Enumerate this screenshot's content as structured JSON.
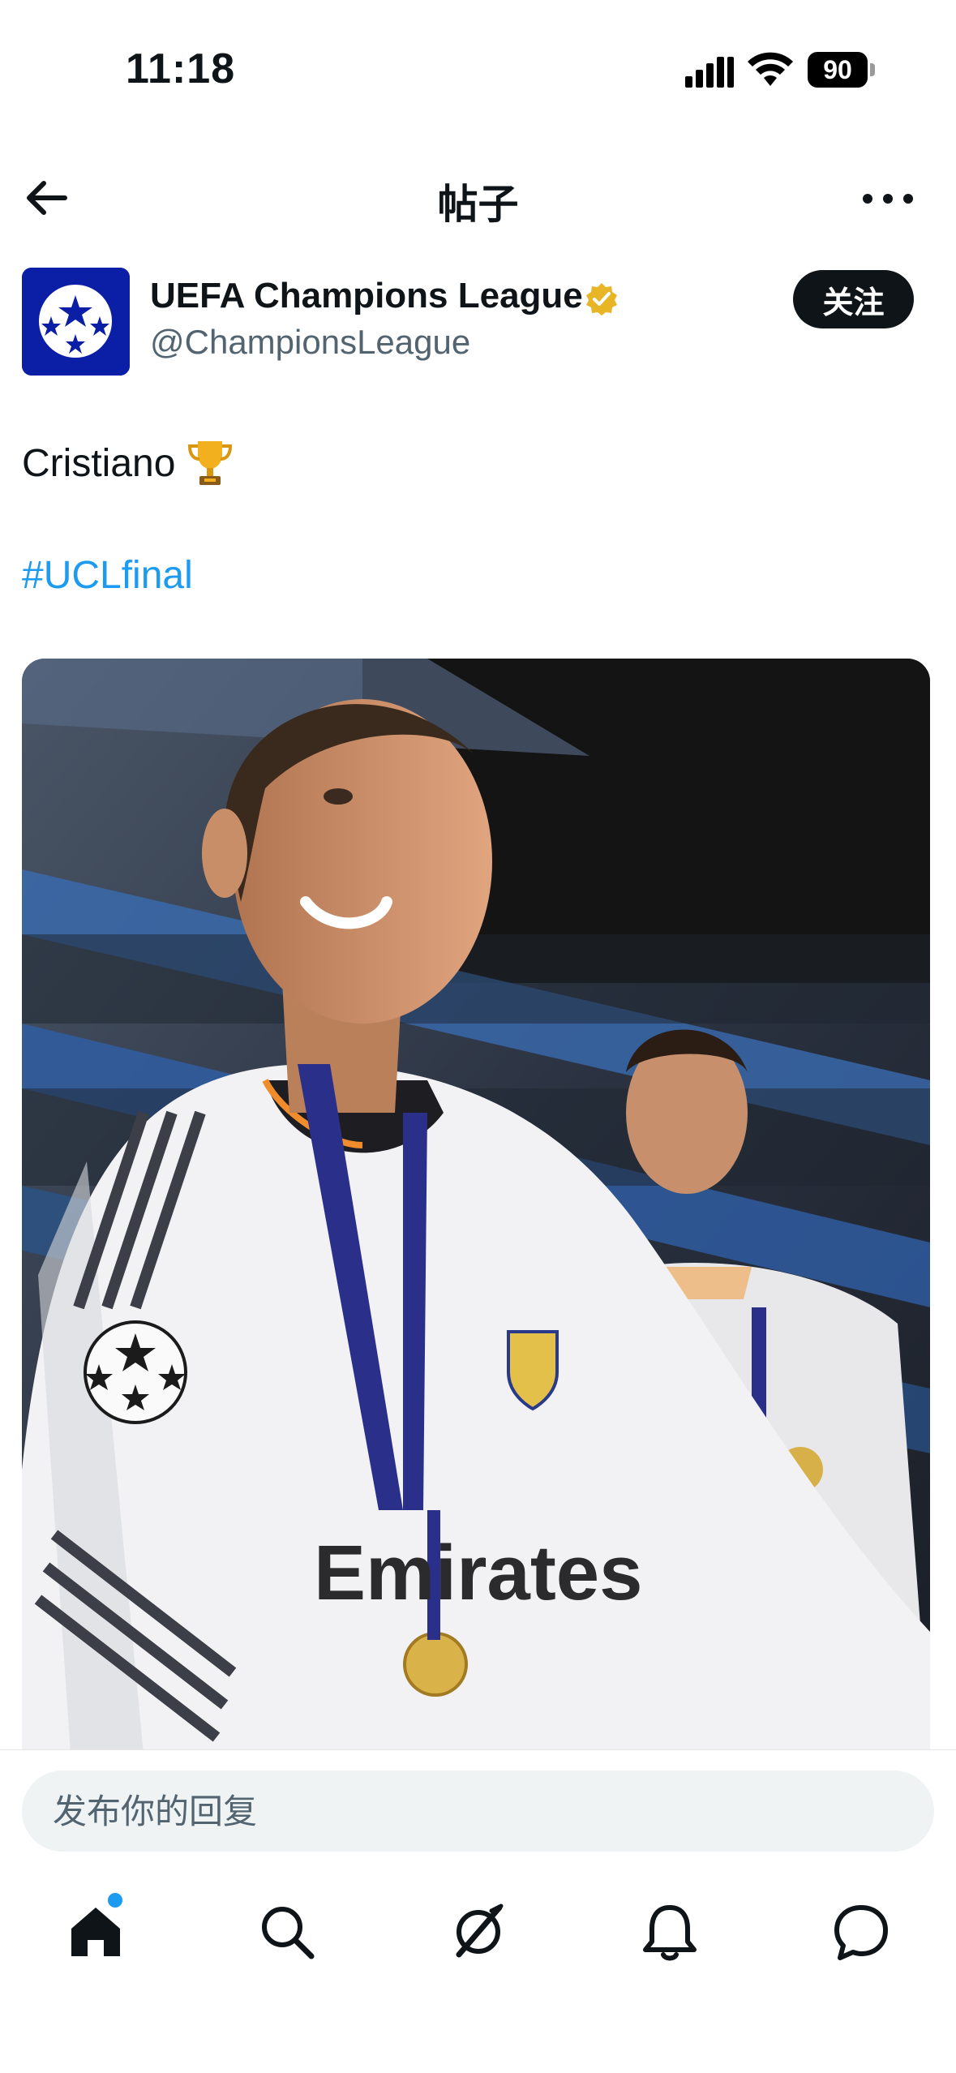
{
  "status_bar": {
    "time": "11:18",
    "battery_level": "90"
  },
  "header": {
    "title": "帖子"
  },
  "author": {
    "name": "UEFA Champions League",
    "handle": "@ChampionsLeague",
    "follow_label": "关注"
  },
  "post": {
    "text": "Cristiano",
    "hashtag": "#UCLfinal"
  },
  "reply": {
    "placeholder": "发布你的回复"
  },
  "tabs": [
    {
      "icon": "home-icon",
      "active": true,
      "has_badge": true
    },
    {
      "icon": "search-icon"
    },
    {
      "icon": "grok-icon"
    },
    {
      "icon": "bell-icon"
    },
    {
      "icon": "messages-icon"
    }
  ],
  "colors": {
    "accent": "#1d9bf0",
    "text": "#0f1419",
    "muted": "#536471",
    "verified": "#e8b526"
  }
}
